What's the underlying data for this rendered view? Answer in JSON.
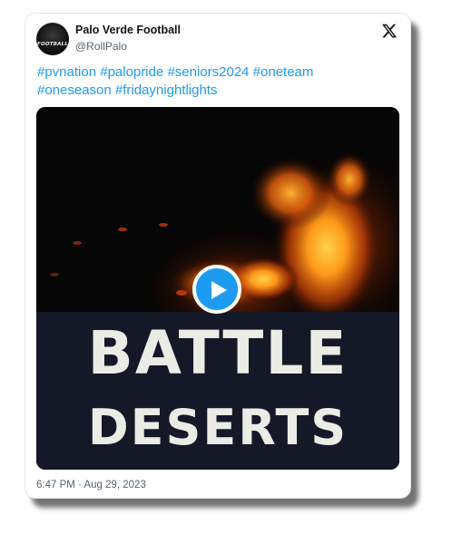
{
  "author": {
    "display_name": "Palo Verde Football",
    "handle": "@RollPalo",
    "avatar_text": "FOOTBALL"
  },
  "tweet": {
    "text_line1": "#pvnation #palopride #seniors2024 #oneteam",
    "text_line2": "#oneseason #fridaynightlights",
    "timestamp": "6:47 PM · Aug 29, 2023"
  },
  "media": {
    "title_line1": "BATTLE",
    "title_line2": "DESERTS",
    "play_icon": "play-icon"
  },
  "icons": {
    "platform": "x-logo-icon"
  },
  "colors": {
    "link": "#1d9bf0",
    "play_button": "#1d9bf0",
    "text_primary": "#0f1419",
    "text_secondary": "#536471",
    "media_lower_bg": "#151826"
  }
}
